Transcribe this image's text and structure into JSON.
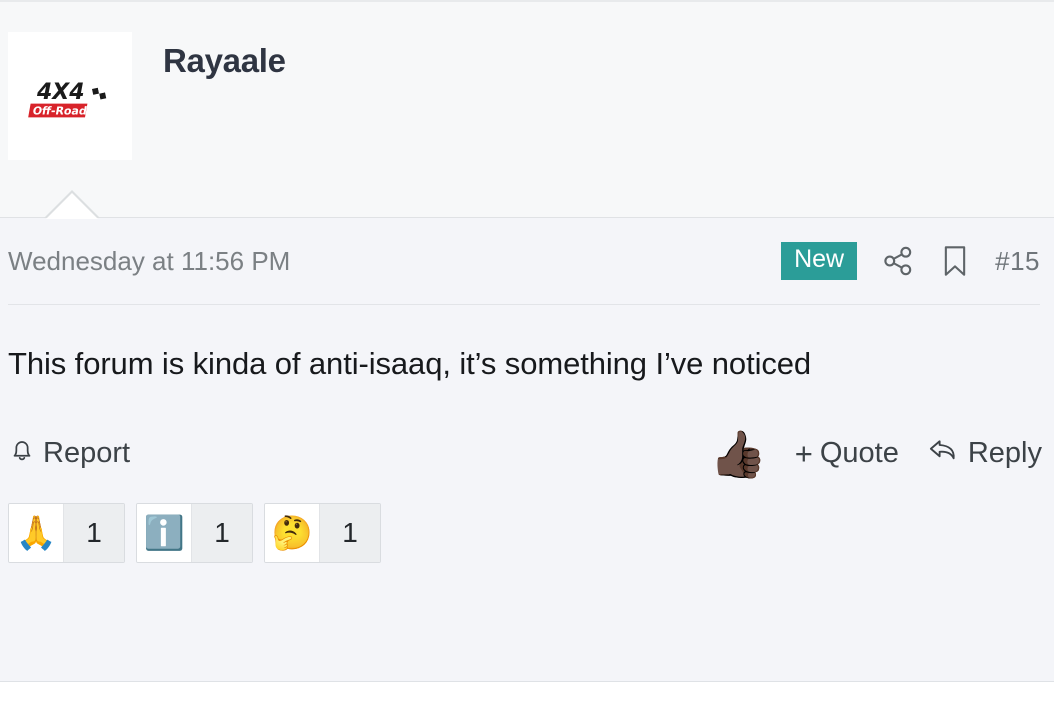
{
  "post": {
    "author": {
      "username": "Rayaale",
      "avatar_alt": "4X4 Off-Road",
      "avatar_text_top": "4X4",
      "avatar_text_bottom": "Off-Road"
    },
    "date": "Wednesday at 11:56 PM",
    "badge": "New",
    "post_number": "#15",
    "message": "This forum is kinda of anti-isaaq, it’s something I’ve noticed",
    "actions": {
      "report": "Report",
      "like_emoji": "👍🏿",
      "quote_plus": "+",
      "quote": "Quote",
      "reply": "Reply"
    },
    "reactions": [
      {
        "emoji": "🙏",
        "name": "folded-hands",
        "count": "1"
      },
      {
        "emoji": "ℹ️",
        "name": "information",
        "count": "1"
      },
      {
        "emoji": "🤔",
        "name": "thinking-face",
        "count": "1"
      }
    ],
    "icons": {
      "share": "share-icon",
      "bookmark": "bookmark-icon",
      "bell": "bell-icon",
      "reply_arrow": "reply-arrow-icon"
    },
    "colors": {
      "badge_bg": "#2b9d98",
      "header_bg": "#f7f8f9",
      "body_bg": "#f4f5f9",
      "text": "#17191c",
      "muted": "#7b8084"
    }
  }
}
